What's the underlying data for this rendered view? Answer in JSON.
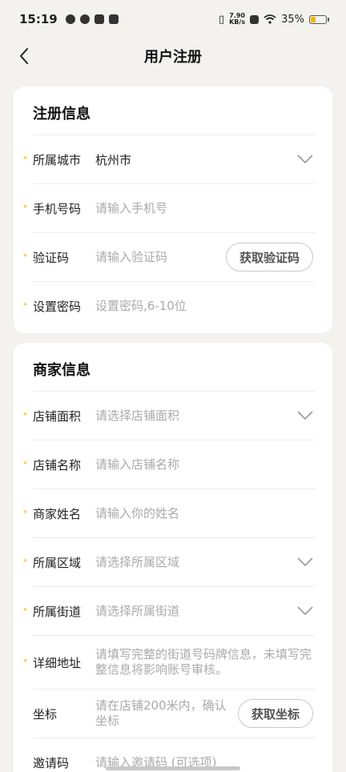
{
  "status_bar": {
    "time": "15:19",
    "net_speed_top": "7.90",
    "net_speed_bottom": "KB/s",
    "battery": "35%",
    "battery_level": 0.35,
    "battery_color": "#f4b400"
  },
  "nav": {
    "title": "用户注册",
    "back_icon": "chevron-left-icon"
  },
  "register": {
    "title": "注册信息",
    "city_label": "所属城市",
    "city_value": "杭州市",
    "phone_label": "手机号码",
    "phone_placeholder": "请输入手机号",
    "code_label": "验证码",
    "code_placeholder": "请输入验证码",
    "code_button": "获取验证码",
    "password_label": "设置密码",
    "password_placeholder": "设置密码,6-10位"
  },
  "merchant": {
    "title": "商家信息",
    "area_label": "店铺面积",
    "area_placeholder": "请选择店铺面积",
    "shop_name_label": "店铺名称",
    "shop_name_placeholder": "请输入店铺名称",
    "owner_label": "商家姓名",
    "owner_placeholder": "请输入你的姓名",
    "region_label": "所属区域",
    "region_placeholder": "请选择所属区域",
    "street_label": "所属街道",
    "street_placeholder": "请选择所属街道",
    "address_label": "详细地址",
    "address_placeholder": "请填写完整的街道号码牌信息，未填写完整信息将影响账号审核。",
    "coord_label": "坐标",
    "coord_placeholder": "请在店铺200米内，确认坐标",
    "coord_button": "获取坐标",
    "invite_label": "邀请码",
    "invite_placeholder": "请输入邀请码 (可选项)"
  },
  "required_mark": "*",
  "accent_color": "#f0b400"
}
